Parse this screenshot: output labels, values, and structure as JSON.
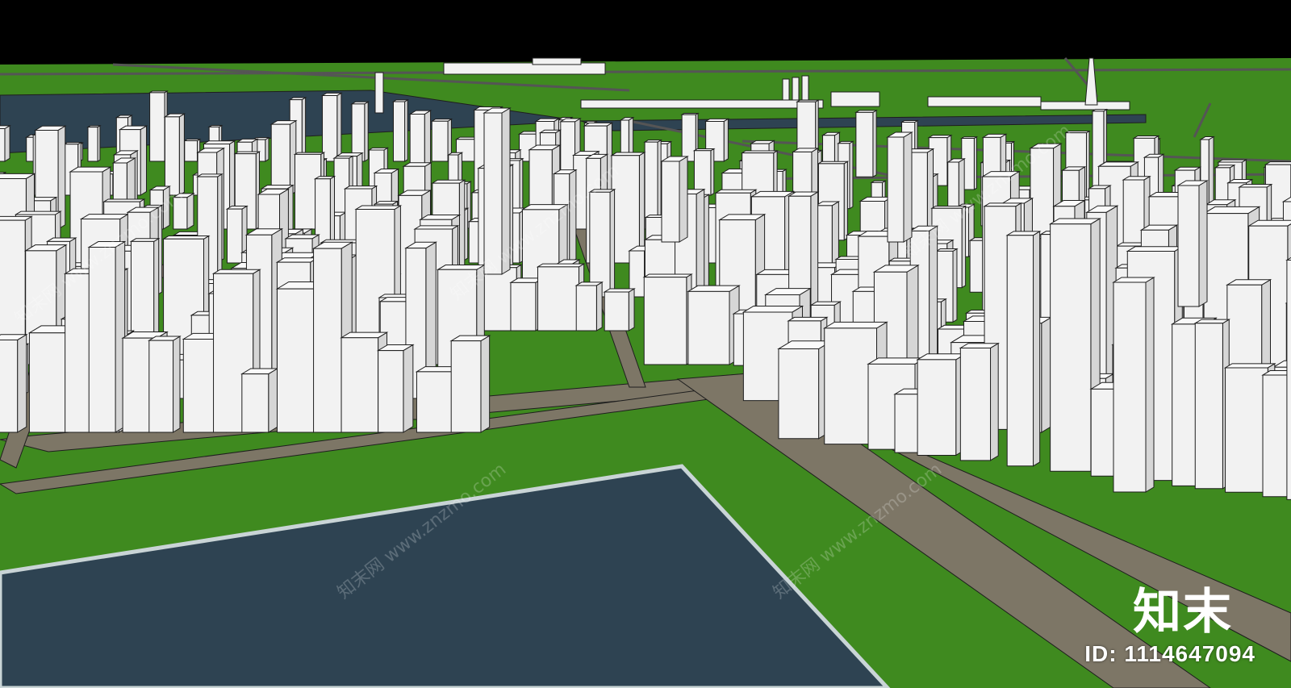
{
  "scene": {
    "colors": {
      "sky": "#000000",
      "ground": "#3f8a1f",
      "water": "#2e4352",
      "road": "#7d7666",
      "building": "#f2f2f2",
      "edge": "#1e1e1e"
    }
  },
  "watermark": {
    "brand": "知末",
    "id_text": "ID: 1114647094",
    "repeat_text": "知末网 www.znzmo.com"
  }
}
